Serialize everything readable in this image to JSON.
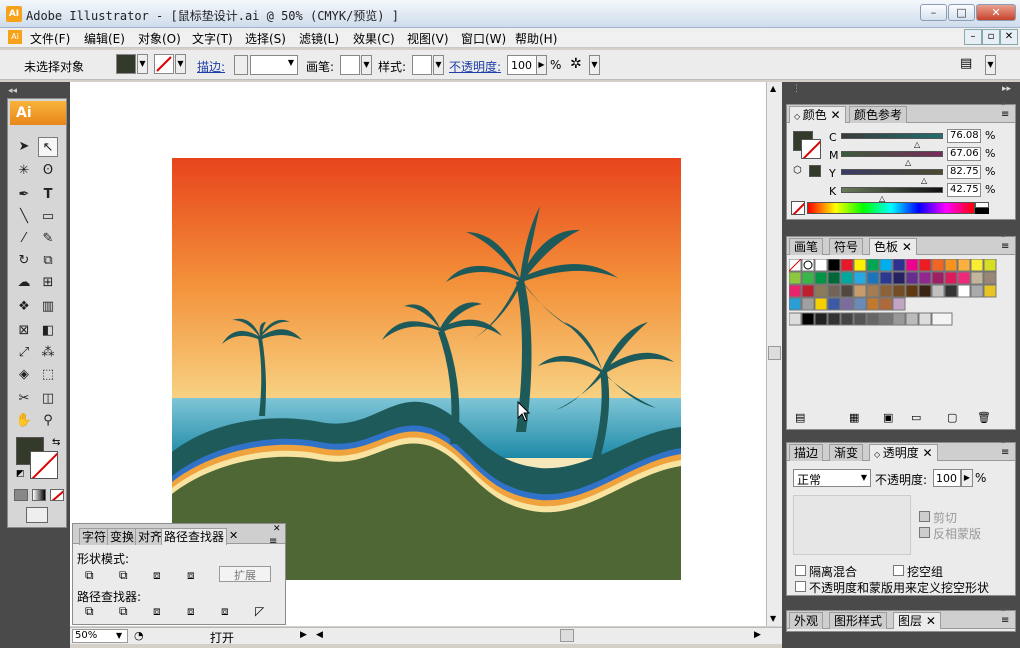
{
  "window": {
    "title": "Adobe Illustrator - [鼠标垫设计.ai @ 50% (CMYK/预览) ]",
    "app_icon": "AI"
  },
  "menu": [
    "文件(F)",
    "编辑(E)",
    "对象(O)",
    "文字(T)",
    "选择(S)",
    "滤镜(L)",
    "效果(C)",
    "视图(V)",
    "窗口(W)",
    "帮助(H)"
  ],
  "control": {
    "selection_label": "未选择对象",
    "stroke_label": "描边:",
    "brush_label": "画笔:",
    "style_label": "样式:",
    "opacity_label": "不透明度:",
    "opacity_value": "100",
    "percent": "%"
  },
  "toolbox": {
    "title": "Ai"
  },
  "color_panel": {
    "tabs": [
      "颜色",
      "颜色参考"
    ],
    "channels": [
      {
        "name": "C",
        "value": "76.08",
        "color": "#3a6f6e"
      },
      {
        "name": "M",
        "value": "67.06",
        "color": "#7a2a5b"
      },
      {
        "name": "Y",
        "value": "82.75",
        "color": "#8a8a2a"
      },
      {
        "name": "K",
        "value": "42.75",
        "color": "#333333"
      }
    ],
    "percent": "%",
    "fill_color": "#333a2a"
  },
  "swatch_panel": {
    "tabs": [
      "画笔",
      "符号",
      "色板"
    ]
  },
  "transparency_panel": {
    "tabs": [
      "描边",
      "渐变",
      "透明度"
    ],
    "mode": "正常",
    "opacity_label": "不透明度:",
    "opacity_value": "100",
    "percent": "%",
    "clip_label": "剪切",
    "invert_label": "反相蒙版",
    "isolate_label": "隔离混合",
    "knockout_label": "挖空组",
    "mask_shape_label": "不透明度和蒙版用来定义挖空形状"
  },
  "bottom_panel": {
    "tabs": [
      "外观",
      "图形样式",
      "图层"
    ]
  },
  "pathfinder": {
    "tabs": [
      "字符",
      "变换",
      "对齐",
      "路径查找器"
    ],
    "shape_modes_label": "形状模式:",
    "expand_label": "扩展",
    "pathfinders_label": "路径查找器:"
  },
  "status": {
    "zoom": "50%",
    "info": "打开"
  }
}
